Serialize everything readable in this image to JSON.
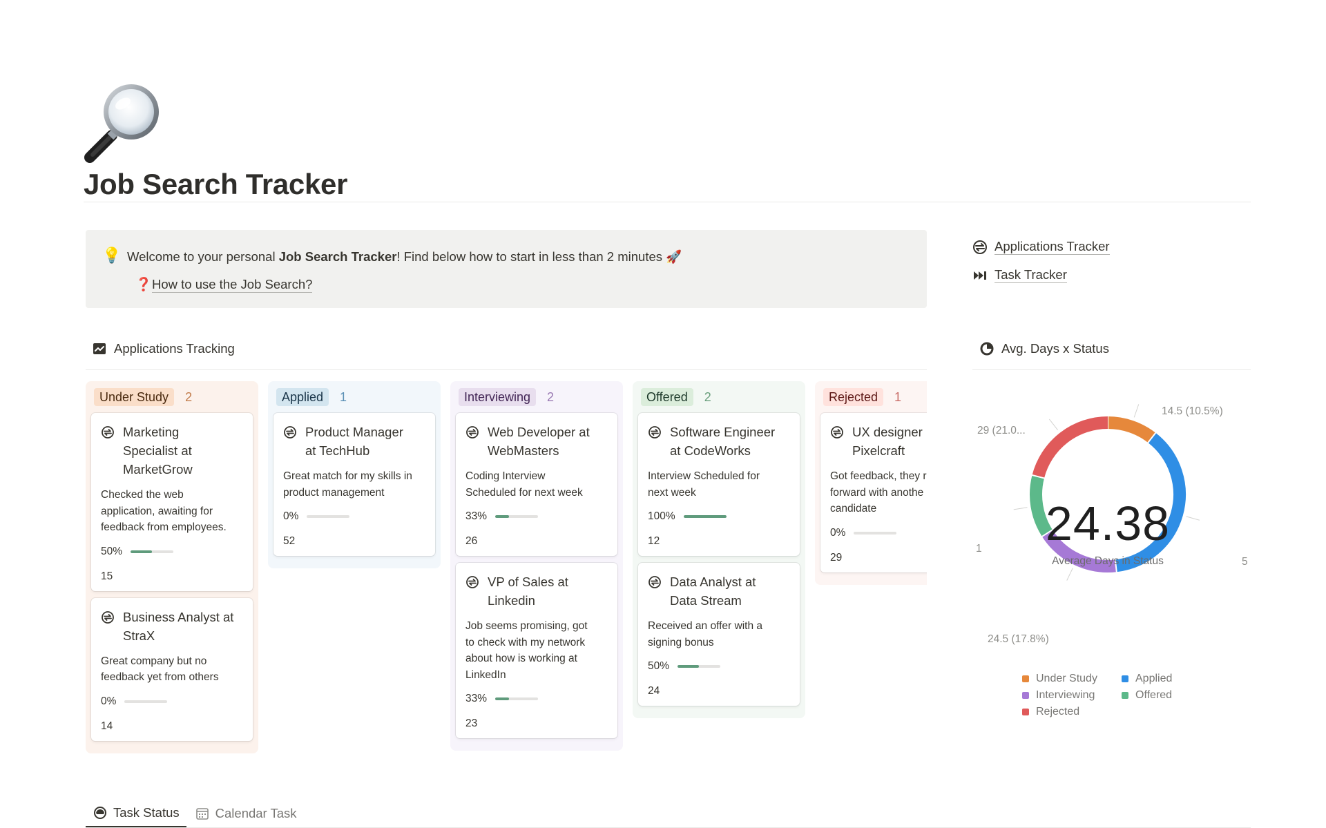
{
  "page": {
    "title": "Job Search Tracker",
    "icon": "magnifying-glass-icon"
  },
  "callout": {
    "icon": "lightbulb-icon",
    "text_before": "Welcome to your personal ",
    "text_bold": "Job Search Tracker",
    "text_after": "! Find below how to start in less than 2 minutes 🚀",
    "link_icon": "question-mark-icon",
    "link_label": "How to use the Job Search?"
  },
  "side_links": [
    {
      "label": "Applications Tracker",
      "icon": "swap-icon"
    },
    {
      "label": "Task Tracker",
      "icon": "fast-forward-icon"
    }
  ],
  "board": {
    "title": "Applications Tracking",
    "icon": "chart-icon",
    "columns": [
      {
        "label": "Under Study",
        "count": "2",
        "colors": {
          "bg": "#fcf2ec",
          "tag_bg": "#fadec9",
          "tag_text": "#49290e",
          "count": "#c27c4b"
        },
        "cards": [
          {
            "title": "Marketing\nSpecialist at\nMarketGrow",
            "note": "Checked the web\napplication, awaiting for\nfeedback from employees.",
            "progress_label": "50%",
            "progress": 0.5,
            "days": "15"
          },
          {
            "title": "Business Analyst at\nStraX",
            "note": "Great company but no\nfeedback yet from others",
            "progress_label": "0%",
            "progress": 0,
            "days": "14"
          }
        ]
      },
      {
        "label": "Applied",
        "count": "1",
        "colors": {
          "bg": "#f2f7fb",
          "tag_bg": "#d3e5ef",
          "tag_text": "#183347",
          "count": "#5a8fb5"
        },
        "cards": [
          {
            "title": "Product Manager\nat TechHub",
            "note": "Great match for my skills in\nproduct management",
            "progress_label": "0%",
            "progress": 0,
            "days": "52"
          }
        ]
      },
      {
        "label": "Interviewing",
        "count": "2",
        "colors": {
          "bg": "#f7f4fb",
          "tag_bg": "#e8deee",
          "tag_text": "#412454",
          "count": "#9a7ab3"
        },
        "cards": [
          {
            "title": "Web Developer at\nWebMasters",
            "note": "Coding Interview\nScheduled for next week",
            "progress_label": "33%",
            "progress": 0.33,
            "days": "26"
          },
          {
            "title": "VP of Sales at\nLinkedin",
            "note": "Job seems promising, got\nto check with my network\nabout how is working at\nLinkedIn",
            "progress_label": "33%",
            "progress": 0.33,
            "days": "23"
          }
        ]
      },
      {
        "label": "Offered",
        "count": "2",
        "colors": {
          "bg": "#f3f8f4",
          "tag_bg": "#dbeddb",
          "tag_text": "#1c3829",
          "count": "#6a9f7c"
        },
        "cards": [
          {
            "title": "Software Engineer\nat CodeWorks",
            "note": "Interview Scheduled for\nnext week",
            "progress_label": "100%",
            "progress": 1.0,
            "days": "12"
          },
          {
            "title": "Data Analyst at\nData Stream",
            "note": "Received an offer with a\nsigning bonus",
            "progress_label": "50%",
            "progress": 0.5,
            "days": "24"
          }
        ]
      },
      {
        "label": "Rejected",
        "count": "1",
        "colors": {
          "bg": "#fdf5f3",
          "tag_bg": "#ffe2dd",
          "tag_text": "#5d1715",
          "count": "#c96d68"
        },
        "cards": [
          {
            "title": "UX designer\nPixelcraft",
            "note": "Got feedback, they r\nforward with anothe\ncandidate",
            "progress_label": "0%",
            "progress": 0,
            "days": "29"
          }
        ]
      }
    ]
  },
  "donut": {
    "title": "Avg. Days x Status",
    "icon": "pie-chart-icon",
    "center_value": "24.38",
    "center_label": "Average Days in Status",
    "slice_labels": {
      "under_study": "14.5 (10.5%)",
      "applied": "5",
      "interviewing": "24.5 (17.8%)",
      "offered": "1",
      "rejected": "29 (21.0..."
    }
  },
  "chart_data": {
    "type": "pie",
    "title": "Avg. Days x Status",
    "center": {
      "value": 24.38,
      "label": "Average Days in Status"
    },
    "slices": [
      {
        "name": "Under Study",
        "value": 14.5,
        "percent": 10.5,
        "color": "#e6883b"
      },
      {
        "name": "Applied",
        "value": 52,
        "percent": 37.7,
        "color": "#2f8ee5"
      },
      {
        "name": "Interviewing",
        "value": 24.5,
        "percent": 17.8,
        "color": "#a679d6"
      },
      {
        "name": "Offered",
        "value": 18,
        "percent": 13.0,
        "color": "#5cb98a"
      },
      {
        "name": "Rejected",
        "value": 29,
        "percent": 21.0,
        "color": "#e05a5a"
      }
    ],
    "legend": [
      "Under Study",
      "Applied",
      "Interviewing",
      "Offered",
      "Rejected"
    ],
    "legend_placement": "bottom"
  },
  "tabs": [
    {
      "label": "Task Status",
      "icon": "gauge-icon",
      "active": true
    },
    {
      "label": "Calendar Task",
      "icon": "calendar-icon",
      "active": false
    }
  ]
}
